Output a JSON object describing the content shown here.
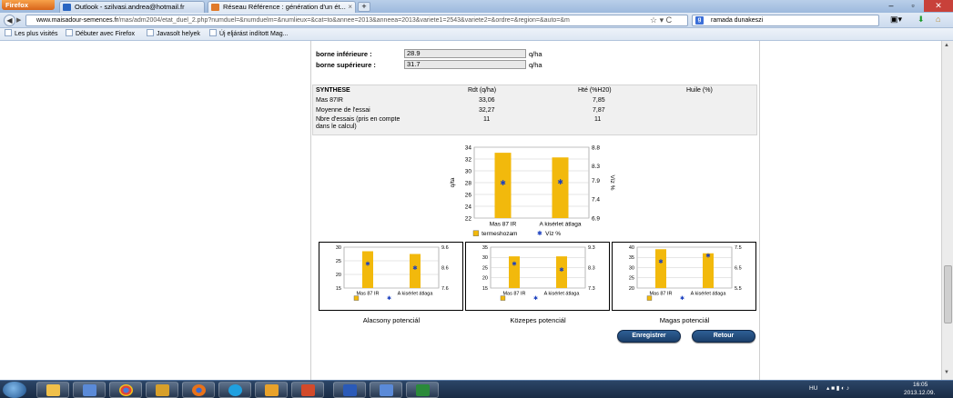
{
  "browser": {
    "app_button": "Firefox",
    "tabs": [
      {
        "label": "Outlook - szilvasi.andrea@hotmail.fr"
      },
      {
        "label": "Réseau Référence : génération d'un ét..."
      }
    ],
    "url_domain": "www.maisadour-semences.fr",
    "url_path": "/mas/adm2004/etat_duel_2.php?numduel=&numduelm=&numlieux=&cat=to&annee=2013&anneea=2013&variete1=2543&variete2=&ordre=&region=&auto=&m",
    "search_value": "ramada dunakeszi",
    "search_engine_icon": "google-icon",
    "bookmarks": [
      "Les plus visités",
      "Débuter avec Firefox",
      "Javasolt helyek",
      "Új eljárást indított Mag..."
    ]
  },
  "form": {
    "borne_inf_label": "borne inférieure :",
    "borne_inf_value": "28.9",
    "borne_sup_label": "borne supérieure :",
    "borne_sup_value": "31.7",
    "unit": "q/ha"
  },
  "synthese": {
    "title": "SYNTHESE",
    "col_rdt": "Rdt (q/ha)",
    "col_hte": "Hté (%H20)",
    "col_huile": "Huile (%)",
    "rows": [
      {
        "label": "Mas 87IR",
        "rdt": "33,06",
        "hte": "7,85"
      },
      {
        "label": "Moyenne de l'essai",
        "rdt": "32,27",
        "hte": "7,87"
      },
      {
        "label": "Nbre d'essais (pris en compte",
        "label2": "dans le calcul)",
        "rdt": "11",
        "hte": "11"
      }
    ]
  },
  "chart_data": [
    {
      "type": "bar",
      "categories": [
        "Mas 87 IR",
        "A kisérlet átlaga"
      ],
      "series": [
        {
          "name": "Termésholzam",
          "values": [
            33.06,
            32.27
          ],
          "axis": "left"
        },
        {
          "name": "Víz %",
          "values": [
            7.85,
            7.87
          ],
          "axis": "right"
        }
      ],
      "ylabel": "q/ta",
      "y2label": "Víz %",
      "ylim": [
        22,
        34
      ],
      "y2lim": [
        6.9,
        8.8
      ],
      "yticks": [
        "34",
        "32",
        "30",
        "28",
        "26",
        "24",
        "22"
      ],
      "y2ticks": [
        "8.8",
        "8.3",
        "7.9",
        "7.4",
        "6.9"
      ],
      "legend": [
        "termeshozam",
        "Víz %"
      ]
    },
    {
      "type": "bar",
      "title": "Alacsony potenciál",
      "categories": [
        "Mas 87 IR",
        "A kisérlet átlaga"
      ],
      "series": [
        {
          "name": "Termésholzam",
          "values": [
            28.5,
            27.5
          ]
        },
        {
          "name": "Víz %",
          "values": [
            8.8,
            8.6
          ]
        }
      ],
      "ylim": [
        15,
        30
      ],
      "y2lim": [
        7.6,
        9.6
      ],
      "yticks": [
        "30",
        "25",
        "20",
        "15"
      ],
      "y2ticks": [
        "9.6",
        "8.6",
        "7.6"
      ]
    },
    {
      "type": "bar",
      "title": "Közepes potenciál",
      "categories": [
        "Mas 87 IR",
        "A kisérlet átlaga"
      ],
      "series": [
        {
          "name": "Termésholzam",
          "values": [
            30.5,
            30.5
          ]
        },
        {
          "name": "Víz %",
          "values": [
            8.5,
            8.2
          ]
        }
      ],
      "ylim": [
        15,
        35
      ],
      "y2lim": [
        7.3,
        9.3
      ],
      "yticks": [
        "35",
        "30",
        "25",
        "20",
        "15"
      ],
      "y2ticks": [
        "9.3",
        "8.3",
        "7.3"
      ]
    },
    {
      "type": "bar",
      "title": "Magas potenciál",
      "categories": [
        "Mas 87 IR",
        "A kisérlet átlaga"
      ],
      "series": [
        {
          "name": "Termésholzam",
          "values": [
            39,
            37
          ]
        },
        {
          "name": "Víz %",
          "values": [
            6.8,
            7.1
          ]
        }
      ],
      "ylim": [
        20,
        40
      ],
      "y2lim": [
        5.5,
        7.5
      ],
      "yticks": [
        "40",
        "35",
        "30",
        "25",
        "20"
      ],
      "y2ticks": [
        "7.5",
        "6.5",
        "5.5"
      ]
    }
  ],
  "buttons": {
    "save": "Enregistrer",
    "back": "Retour"
  },
  "taskbar": {
    "lang": "HU",
    "time": "16:05",
    "date": "2013.12.09."
  },
  "colors": {
    "bar": "#f2b90c",
    "point": "#1a3fbf"
  }
}
